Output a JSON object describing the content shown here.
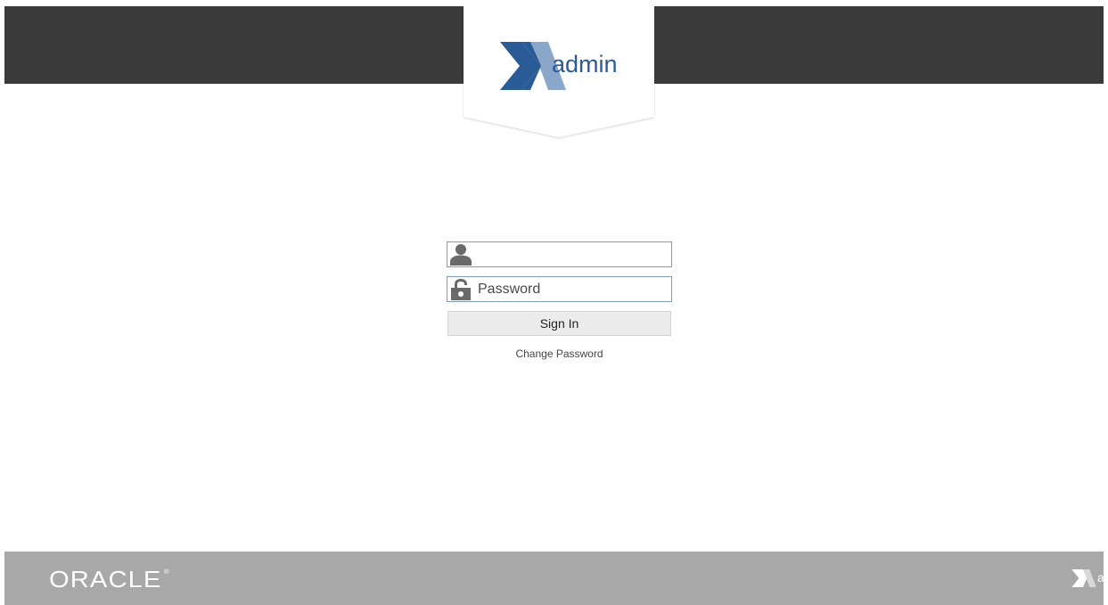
{
  "header": {
    "brand_text": "admin",
    "colors": {
      "bar": "#3a3a3a",
      "brand_dark_blue": "#2a5b96",
      "brand_light_blue": "#8aa7c9"
    }
  },
  "login": {
    "username": {
      "placeholder": "",
      "value": "",
      "icon": "user-icon"
    },
    "password": {
      "placeholder": "Password",
      "value": "",
      "icon": "lock-icon"
    },
    "signin_label": "Sign In",
    "change_password_label": "Change Password"
  },
  "footer": {
    "oracle_logo_text": "ORACLE",
    "oracle_registered_mark": "®",
    "brand_text": "admin",
    "colors": {
      "bar": "#a8a8a8"
    }
  }
}
